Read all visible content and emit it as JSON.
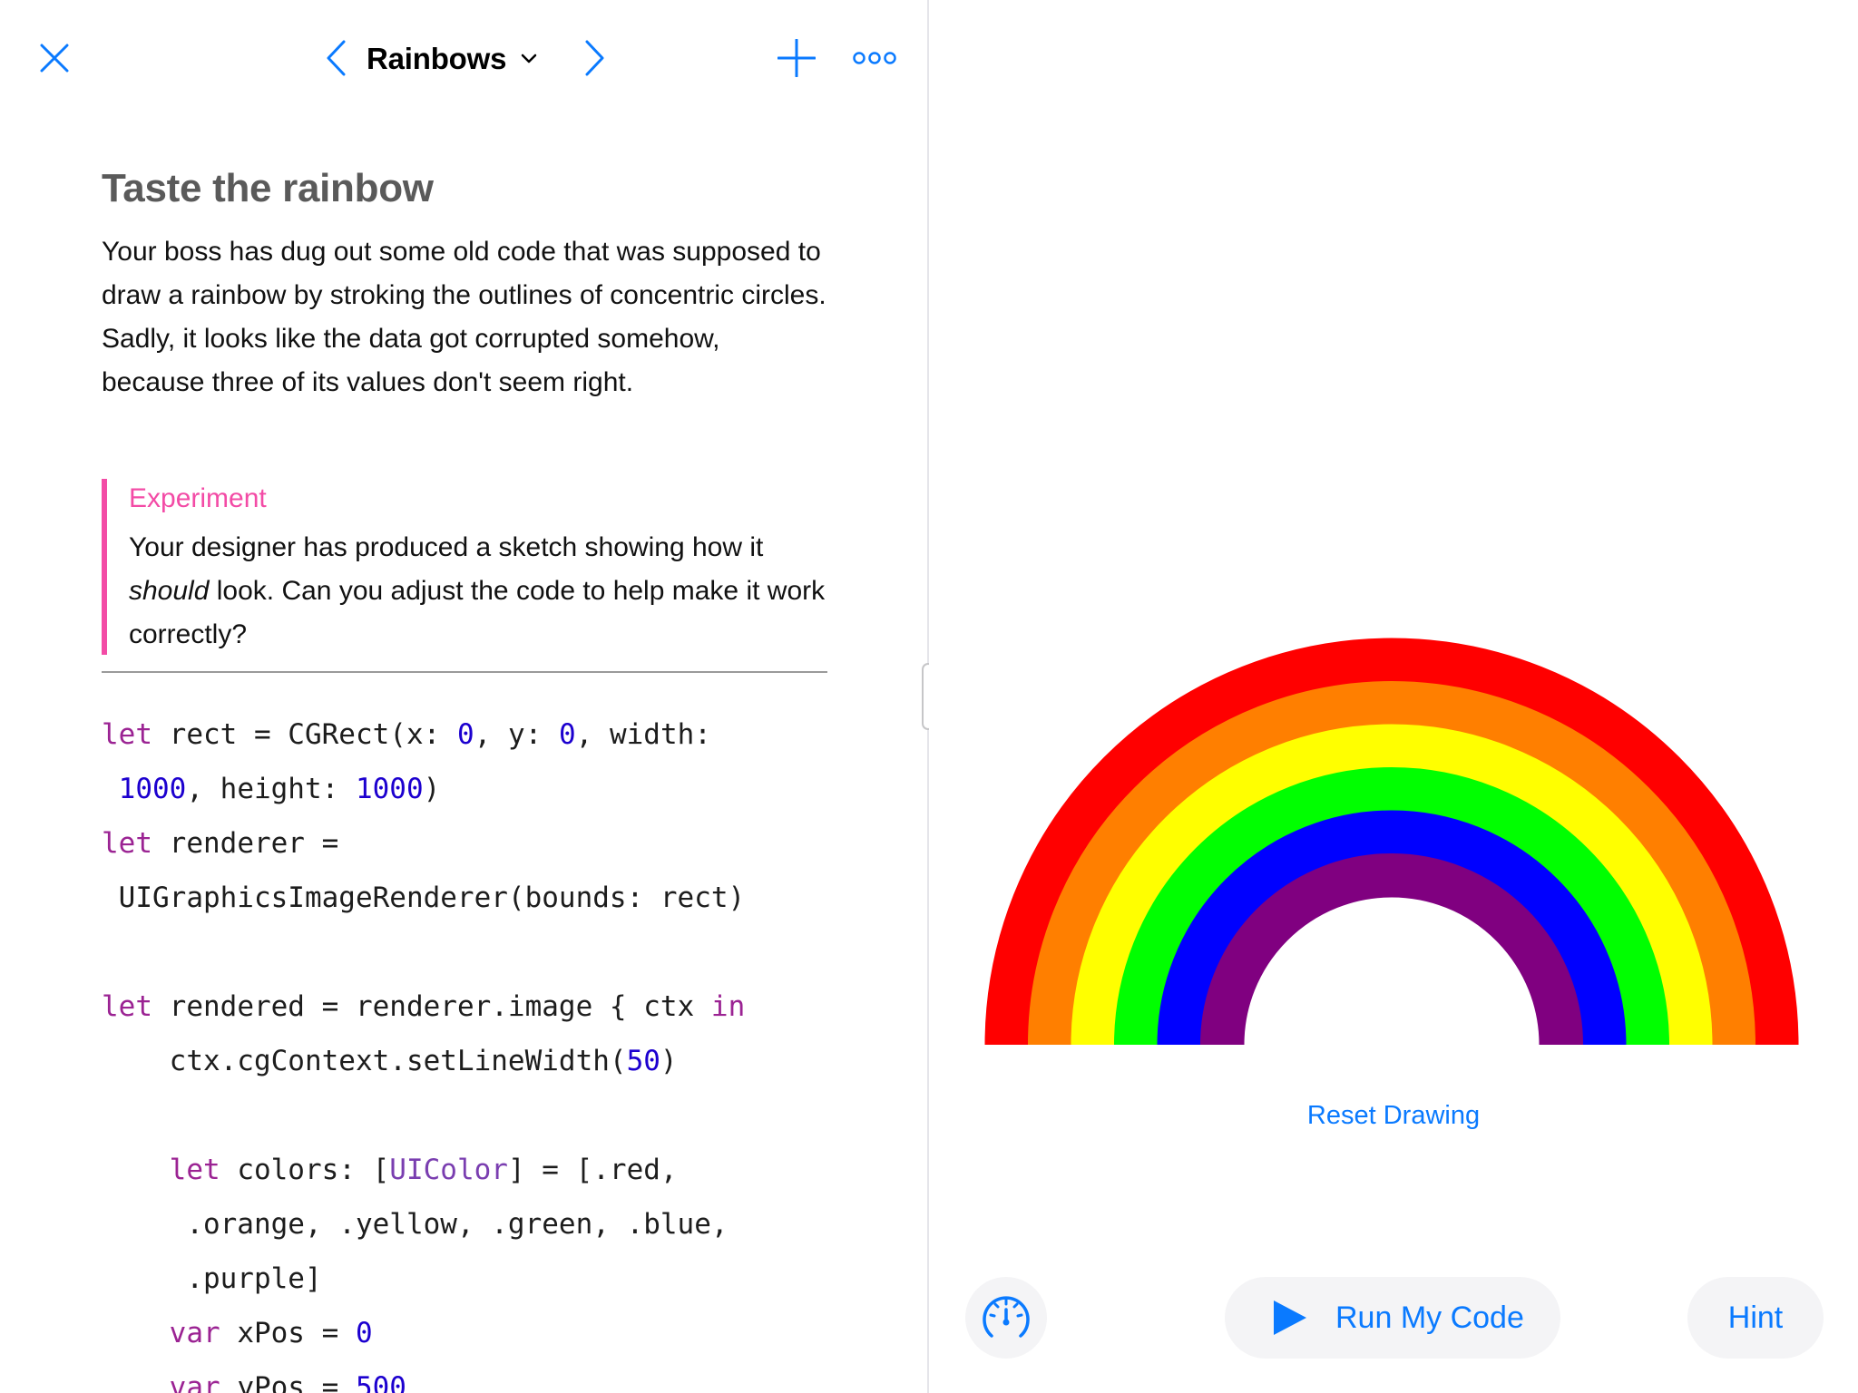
{
  "accent_color": "#0a7aff",
  "callout_color": "#f34ba6",
  "nav": {
    "title": "Rainbows",
    "icons": {
      "close": "close-icon",
      "prev": "chevron-left-icon",
      "next": "chevron-right-icon",
      "title_menu": "chevron-down-icon",
      "add": "plus-icon",
      "more": "more-icon"
    }
  },
  "content": {
    "heading": "Taste the rainbow",
    "intro": "Your boss has dug out some old code that was supposed to draw a rainbow by stroking the outlines of concentric circles. Sadly, it looks like the data got corrupted somehow, because three of its values don't seem right.",
    "callout": {
      "title": "Experiment",
      "body_before": "Your designer has produced a sketch showing how it ",
      "body_emphasis": "should",
      "body_after": " look. Can you adjust the code to help make it work correctly?"
    }
  },
  "code": {
    "l1": [
      "let",
      " rect = CGRect(x: ",
      "0",
      ", y: ",
      "0",
      ", width:"
    ],
    "l2": [
      " ",
      "1000",
      ", height: ",
      "1000",
      ")"
    ],
    "l3": [
      "let",
      " renderer ="
    ],
    "l4": " UIGraphicsImageRenderer(bounds: rect)",
    "l5": [
      "let",
      " rendered = renderer.image { ctx ",
      "in"
    ],
    "l6": [
      "    ctx.cgContext.setLineWidth(",
      "50",
      ")"
    ],
    "l7": [
      "    ",
      "let",
      " colors: [",
      "UIColor",
      "] = [.red,"
    ],
    "l8": "     .orange, .yellow, .green, .blue,",
    "l9": "     .purple]",
    "l10": [
      "    ",
      "var",
      " xPos = ",
      "0"
    ],
    "l11": [
      "    ",
      "var",
      " yPos = ",
      "500"
    ]
  },
  "canvas": {
    "rainbow_colors": [
      "#ff0000",
      "#ff7f00",
      "#ffff00",
      "#00ff00",
      "#0000ff",
      "#800080"
    ]
  },
  "actions": {
    "reset": "Reset Drawing",
    "run": "Run My Code",
    "hint": "Hint",
    "icons": {
      "speed": "speedometer-icon",
      "run": "play-icon"
    }
  }
}
